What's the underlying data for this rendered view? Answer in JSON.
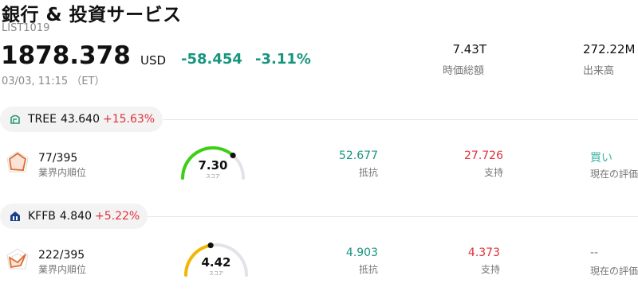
{
  "header": {
    "title": "銀行 & 投資サービス",
    "code": "LIST1019",
    "price": "1878.378",
    "currency": "USD",
    "change": "-58.454",
    "change_pct": "-3.11%",
    "timestamp": "03/03, 11:15 （ET）"
  },
  "stats": [
    {
      "value": "7.43T",
      "label": "時価総額"
    },
    {
      "value": "272.22M",
      "label": "出来高"
    }
  ],
  "stocks": [
    {
      "ticker": "TREE",
      "price": "43.640",
      "change_pct": "+15.63%",
      "rank": "77/395",
      "rank_label": "業界内順位",
      "score": "7.30",
      "score_label": "スコア",
      "score_level": 0.73,
      "resistance": "52.677",
      "resistance_label": "抵抗",
      "support": "27.726",
      "support_label": "支持",
      "evaluation": "買い",
      "evaluation_label": "現在の評価",
      "colors": {
        "gauge": "#3ccf12",
        "icon": "#2a9a72"
      }
    },
    {
      "ticker": "KFFB",
      "price": "4.840",
      "change_pct": "+5.22%",
      "rank": "222/395",
      "rank_label": "業界内順位",
      "score": "4.42",
      "score_label": "スコア",
      "score_level": 0.442,
      "resistance": "4.903",
      "resistance_label": "抵抗",
      "support": "4.373",
      "support_label": "支持",
      "evaluation": "--",
      "evaluation_label": "現在の評価",
      "colors": {
        "gauge": "#f2b705",
        "icon": "#1d3f8a"
      }
    }
  ],
  "colors": {
    "up": "#17957f",
    "down": "#e0303a",
    "buy": "#3cb4a8"
  }
}
